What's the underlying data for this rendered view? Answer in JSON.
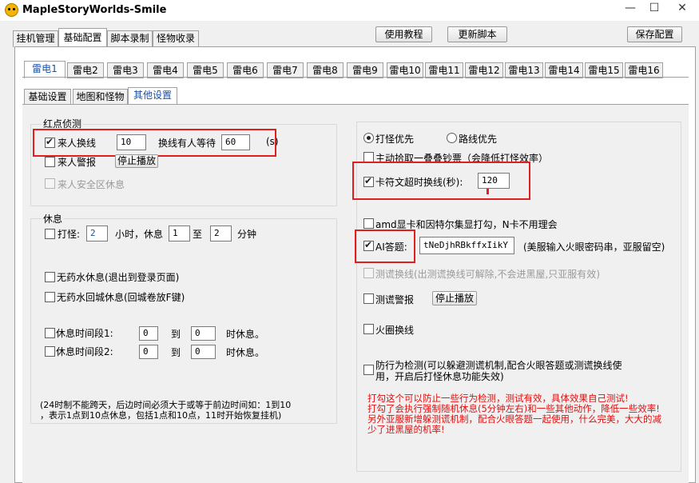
{
  "window": {
    "title": "MapleStoryWorlds-Smile"
  },
  "main_tabs": [
    "挂机管理",
    "基础配置",
    "脚本录制",
    "怪物收录"
  ],
  "toolbar": {
    "tutorial": "使用教程",
    "update": "更新脚本",
    "save": "保存配置"
  },
  "char_tabs": [
    "雷电1",
    "雷电2",
    "雷电3",
    "雷电4",
    "雷电5",
    "雷电6",
    "雷电7",
    "雷电8",
    "雷电9",
    "雷电10",
    "雷电11",
    "雷电12",
    "雷电13",
    "雷电14",
    "雷电15",
    "雷电16"
  ],
  "sub_tabs": [
    "基础设置",
    "地图和怪物",
    "其他设置"
  ],
  "redname": {
    "title": "红点侦测",
    "switch_label": "来人换线",
    "switch_value": "10",
    "wait_label": "换线有人等待",
    "wait_value": "60",
    "unit": "(s)",
    "alarm_label": "来人警报",
    "stop_play": "停止播放",
    "safe_label": "来人安全区休息"
  },
  "rest": {
    "title": "休息",
    "hunt_label": "打怪:",
    "hunt_value": "2",
    "hours_label": "小时，休息",
    "min_value": "1",
    "to": "至",
    "max_value": "2",
    "minutes": "分钟",
    "no_potion_logout": "无药水休息(退出到登录页面)",
    "no_potion_town": "无药水回城休息(回城卷放F键)",
    "period1_label": "休息时间段1:",
    "period1_from": "0",
    "period1_to": "0",
    "period2_label": "休息时间段2:",
    "period2_from": "0",
    "period2_to": "0",
    "to_word": "到",
    "rest_suffix": "时休息。",
    "note": "(24时制不能跨天，后边时间必须大于或等于前边时间如：1到10\n，表示1点到10点休息，包括1点和10点，11时开始恢复挂机)"
  },
  "right": {
    "priority_hunt": "打怪优先",
    "priority_path": "路线优先",
    "pickup_label": "主动拾取一叠叠钞票（会降低打怪效率）",
    "rune_label": "卡符文超时换线(秒):",
    "rune_value": "120",
    "amd_label": "amd显卡和因特尔集显打勾，N卡不用理会",
    "ai_label": "AI答题:",
    "ai_value": "tNeDjhRBkffxIikY",
    "ai_hint": "(美服输入火眼密码串，亚服留空)",
    "lie_switch_label": "测谎换线(出测谎换线可解除,不会进黑屋,只亚服有效)",
    "lie_alarm_label": "测谎警报",
    "stop_play": "停止播放",
    "fire_label": "火圈换线",
    "detect_label": "防行为检测(可以躲避测谎机制,配合火眼答题或测谎换线使\n用，开启后打怪休息功能失效)",
    "warning": "打勾这个可以防止一些行为检测，测试有效，具体效果自己测试!\n打勾了会执行强制随机休息(5分钟左右)和一些其他动作，降低一些效率!\n另外亚服新增躲测谎机制，配合火眼答题一起使用，什么完美，大大的减\n少了进黑屋的机率!"
  },
  "colors": {
    "highlight_border": "#e02020",
    "warning_text": "#e01010",
    "active_tab_text": "#1a4fa3"
  }
}
